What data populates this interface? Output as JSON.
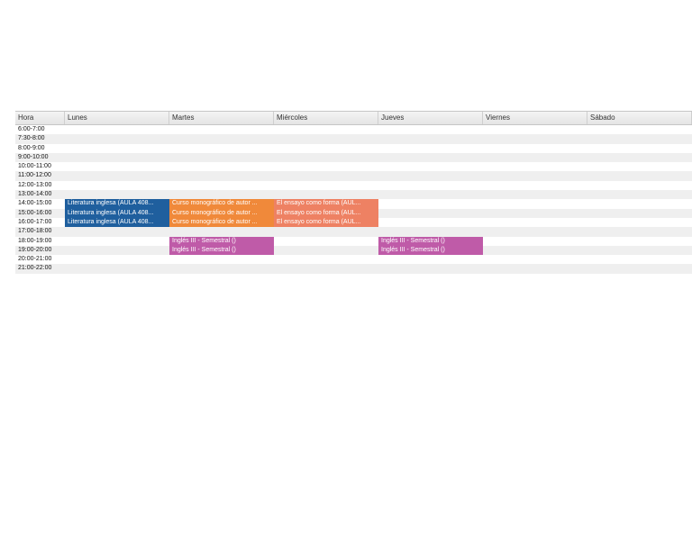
{
  "header": [
    "Hora",
    "Lunes",
    "Martes",
    "Miércoles",
    "Jueves",
    "Viernes",
    "Sábado"
  ],
  "rows": [
    {
      "hour": "6:00-7:00",
      "cells": [
        "",
        "",
        "",
        "",
        "",
        ""
      ]
    },
    {
      "hour": "7:30-8:00",
      "cells": [
        "",
        "",
        "",
        "",
        "",
        ""
      ]
    },
    {
      "hour": "8:00-9:00",
      "cells": [
        "",
        "",
        "",
        "",
        "",
        ""
      ]
    },
    {
      "hour": "9:00-10:00",
      "cells": [
        "",
        "",
        "",
        "",
        "",
        ""
      ]
    },
    {
      "hour": "10:00-11:00",
      "cells": [
        "",
        "",
        "",
        "",
        "",
        ""
      ]
    },
    {
      "hour": "11:00-12:00",
      "cells": [
        "",
        "",
        "",
        "",
        "",
        ""
      ]
    },
    {
      "hour": "12:00-13:00",
      "cells": [
        "",
        "",
        "",
        "",
        "",
        ""
      ]
    },
    {
      "hour": "13:00-14:00",
      "cells": [
        "",
        "",
        "",
        "",
        "",
        ""
      ]
    },
    {
      "hour": "14:00-15:00",
      "cells": [
        "Literatura inglesa (AULA 408...",
        "Curso monográfico de autor ...",
        "El ensayo como forma (AUL...",
        "",
        "",
        ""
      ]
    },
    {
      "hour": "15:00-16:00",
      "cells": [
        "Literatura inglesa (AULA 408...",
        "Curso monográfico de autor ...",
        "El ensayo como forma (AUL...",
        "",
        "",
        ""
      ]
    },
    {
      "hour": "16:00-17:00",
      "cells": [
        "Literatura inglesa (AULA 408...",
        "Curso monográfico de autor ...",
        "El ensayo como forma (AUL...",
        "",
        "",
        ""
      ]
    },
    {
      "hour": "17:00-18:00",
      "cells": [
        "",
        "",
        "",
        "",
        "",
        ""
      ]
    },
    {
      "hour": "18:00-19:00",
      "cells": [
        "",
        "Inglés III - Semestral ()",
        "",
        "Inglés III - Semestral ()",
        "",
        ""
      ]
    },
    {
      "hour": "19:00-20:00",
      "cells": [
        "",
        "Inglés III - Semestral ()",
        "",
        "Inglés III - Semestral ()",
        "",
        ""
      ]
    },
    {
      "hour": "20:00-21:00",
      "cells": [
        "",
        "",
        "",
        "",
        "",
        ""
      ]
    },
    {
      "hour": "21:00-22:00",
      "cells": [
        "",
        "",
        "",
        "",
        "",
        ""
      ]
    }
  ],
  "colors": {
    "literatura": "#1f5f9e",
    "curso": "#f0893a",
    "ensayo": "#ee8163",
    "ingles": "#bf5ba8"
  }
}
